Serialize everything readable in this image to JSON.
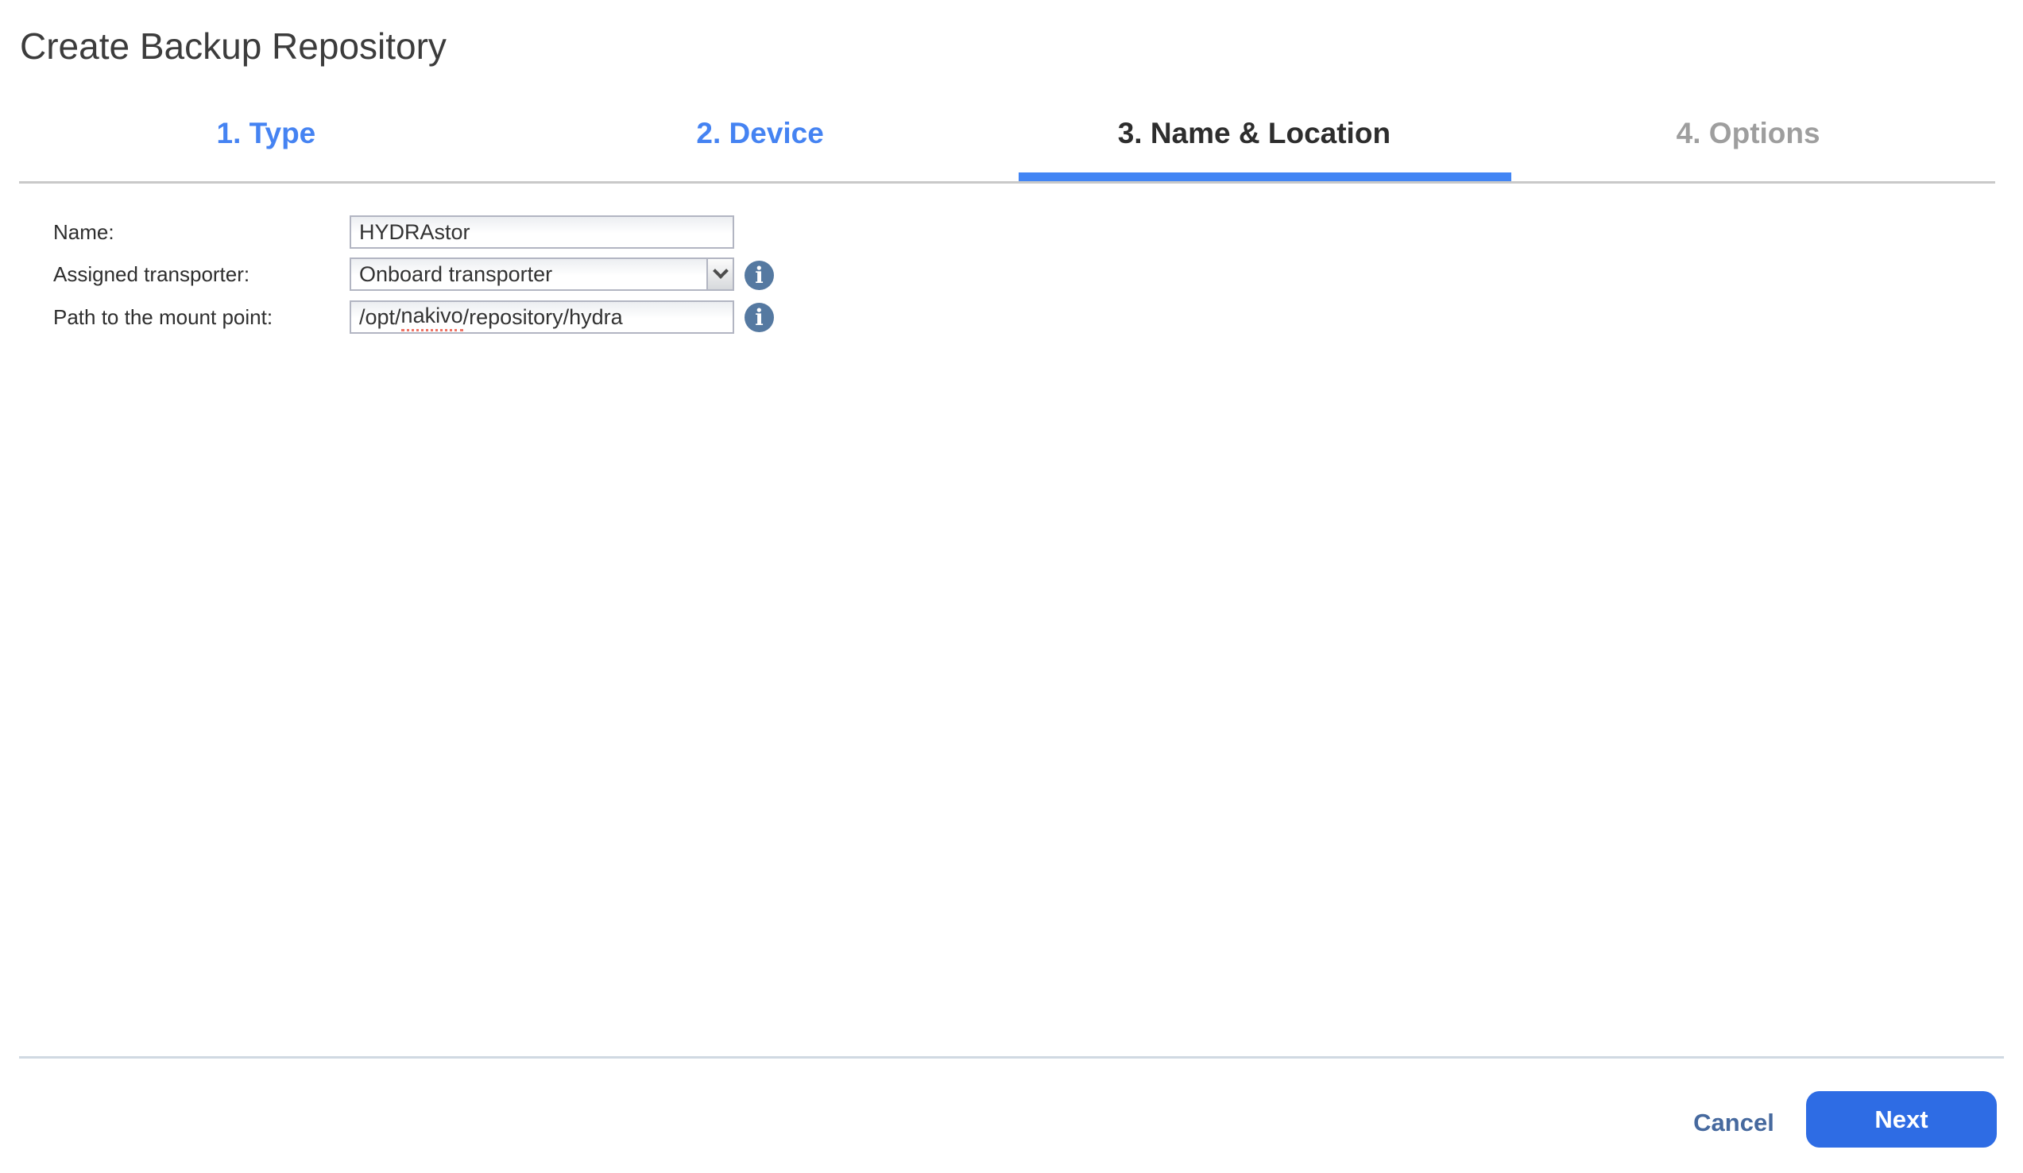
{
  "window": {
    "title": "Create Backup Repository"
  },
  "steps": [
    {
      "label": "1. Type",
      "state": "done"
    },
    {
      "label": "2. Device",
      "state": "done"
    },
    {
      "label": "3. Name & Location",
      "state": "active"
    },
    {
      "label": "4. Options",
      "state": "upcoming"
    }
  ],
  "form": {
    "name": {
      "label": "Name:",
      "value": "HYDRAstor"
    },
    "transporter": {
      "label": "Assigned transporter:",
      "value": "Onboard transporter",
      "icon": "info-icon"
    },
    "mount_path": {
      "label": "Path to the mount point:",
      "value": "/opt/nakivo/repository/hydra",
      "value_before": "/opt/",
      "value_misspelled": "nakivo",
      "value_after": "/repository/hydra",
      "icon": "info-icon"
    }
  },
  "footer": {
    "cancel_label": "Cancel",
    "next_label": "Next"
  },
  "colors": {
    "step_link_blue": "#4583f2",
    "active_bar_blue": "#4285f4",
    "next_button_blue": "#2e6ce4",
    "cancel_link_blue": "#46699e",
    "info_icon_blue": "#5579a1",
    "inactive_step_gray": "#9e9e9e",
    "tab_line_gray": "#c9c9c9",
    "footer_line_gray": "#d0d9e2"
  }
}
